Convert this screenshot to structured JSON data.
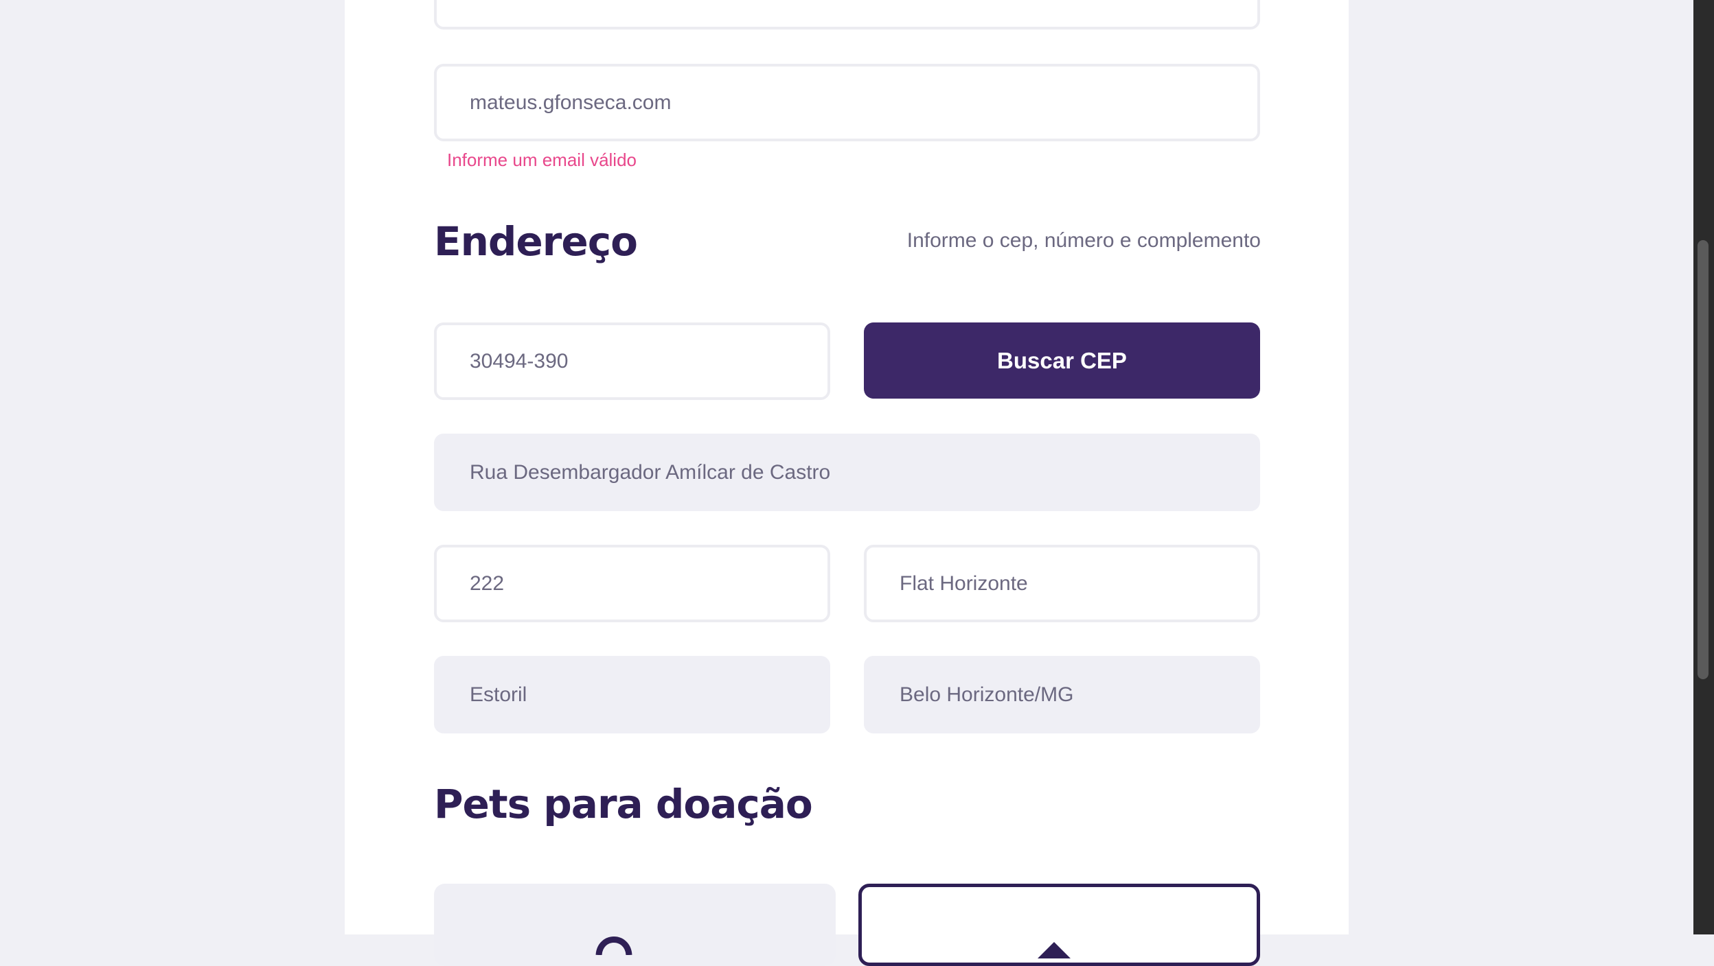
{
  "form": {
    "email_value": "mateus.gfonseca.com",
    "email_error": "Informe um email válido",
    "address_title": "Endereço",
    "address_hint": "Informe o cep, número e complemento",
    "cep_value": "30494-390",
    "search_cep_label": "Buscar CEP",
    "street_value": "Rua Desembargador Amílcar de Castro",
    "number_value": "222",
    "complement_value": "Flat Horizonte",
    "neighborhood_value": "Estoril",
    "city_value": "Belo Horizonte/MG",
    "pets_title": "Pets para doação"
  },
  "colors": {
    "accent": "#3d2868",
    "title": "#2e1f55",
    "error": "#e8478b"
  },
  "icons": {
    "pet_card_1": "dog-icon",
    "pet_card_2": "cat-icon"
  }
}
